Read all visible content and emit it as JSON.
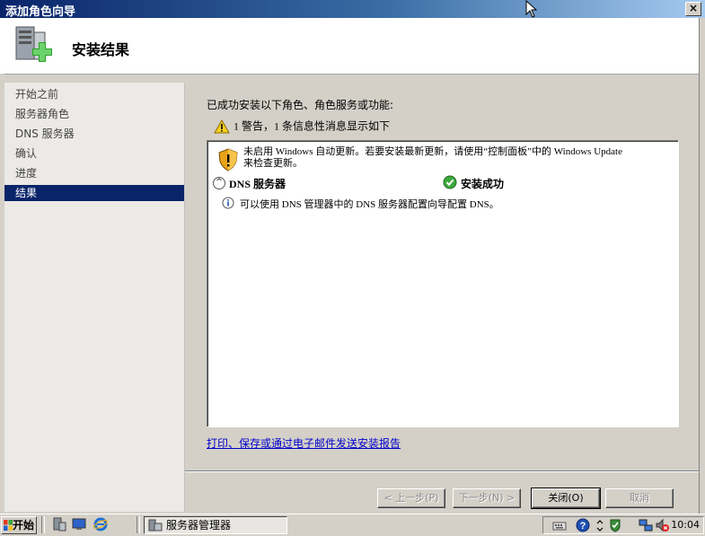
{
  "window": {
    "title": "添加角色向导",
    "close_glyph": "×"
  },
  "header": {
    "title": "安装结果",
    "icon": "server-add-icon"
  },
  "steps": [
    {
      "label": "开始之前",
      "active": false
    },
    {
      "label": "服务器角色",
      "active": false
    },
    {
      "label": "DNS 服务器",
      "active": false
    },
    {
      "label": "确认",
      "active": false
    },
    {
      "label": "进度",
      "active": false
    },
    {
      "label": "结果",
      "active": true
    }
  ],
  "main": {
    "intro": "已成功安装以下角色、角色服务或功能:",
    "summary": "1 警告，1 条信息性消息显示如下",
    "results": {
      "warning_line1": "未启用 Windows 自动更新。若要安装最新更新，请使用“控制面板”中的 Windows Update",
      "warning_line2": "来检查更新。",
      "role_name": "DNS 服务器",
      "role_status": "安装成功",
      "info_message": "可以使用 DNS 管理器中的 DNS 服务器配置向导配置 DNS。"
    },
    "report_link": "打印、保存或通过电子邮件发送安装报告"
  },
  "buttons": {
    "back": "< 上一步(P)",
    "next": "下一步(N) >",
    "close": "关闭(O)",
    "cancel": "取消"
  },
  "taskbar": {
    "start": "开始",
    "task": "服务器管理器",
    "clock": "10:04"
  },
  "colors": {
    "selection": "#0a246a",
    "link": "#0000cc",
    "title_gradient_start": "#0a246a"
  }
}
